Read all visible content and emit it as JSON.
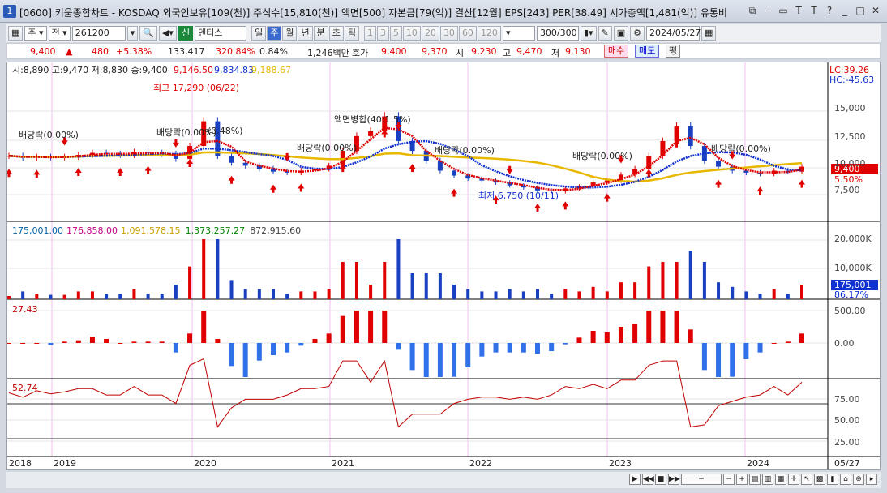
{
  "window": {
    "title": "[0600] 키움종합차트 - KOSDAQ 외국인보유[109(천)] 주식수[15,810(천)] 액면[500] 자본금[79(억)] 결산[12월] EPS[243] PER[38.49] 시가총액[1,481(억)] 유통비",
    "app_icon": "1"
  },
  "toolbar": {
    "period_select": "주",
    "field_select": "전",
    "code": "261200",
    "sin_badge": "신",
    "name": "덴티스",
    "periods": [
      "일",
      "주",
      "월",
      "년",
      "분",
      "초",
      "틱"
    ],
    "active_period": "주",
    "numbers": [
      "1",
      "3",
      "5",
      "10",
      "20",
      "30",
      "60",
      "120"
    ],
    "count": "300/300",
    "date": "2024/05/27"
  },
  "quote": {
    "price": "9,400",
    "change_arrow": "▲",
    "change": "480",
    "rate": "+5.38%",
    "volume": "133,417",
    "volume_rate": "320.84%",
    "turnover": "0.84%",
    "amount": "1,246백만",
    "hoga_label": "호가",
    "ask": "9,400",
    "bid": "9,370",
    "open_label": "시",
    "open": "9,230",
    "high_label": "고",
    "high": "9,470",
    "low_label": "저",
    "low": "9,130",
    "buy_label": "매수",
    "sell_label": "매도",
    "flat_label": "평"
  },
  "price_panel": {
    "ohlc_legend": "시:8,890 고:9,470 저:8,830 종:9,400",
    "ma_values": [
      "9,146.50",
      "9,834.83",
      "9,188.67"
    ],
    "lc": "LC:39.26",
    "hc": "HC:-45.63",
    "high_annot": "최고 17,290 (06/22)",
    "low_annot": "최저 6,750 (10/11)",
    "merge_annot": "액면병합(40:1.5%)",
    "dividend_annots": [
      "배당락(0.00%)",
      "배당락(0.00%)",
      "(0.48%)",
      "배당락(0.00%)",
      "배당락(0.00%)",
      "배당락(0.00%)",
      "배당락(0.00%)"
    ],
    "y_ticks": [
      "15,000",
      "12,500",
      "10,000",
      "7,500"
    ],
    "price_tag": "9,400",
    "pct_tag": "5.50%",
    "signal_up_count": 22,
    "signal_down_count": 7
  },
  "volume_panel": {
    "legend": [
      "175,001.00",
      "176,858.00",
      "1,091,578.15",
      "1,373,257.27",
      "872,915.60"
    ],
    "legend_colors": [
      "#0060a0",
      "#c00080",
      "#c8a000",
      "#008000",
      "#444444"
    ],
    "y_ticks": [
      "20,000K",
      "10,000K"
    ],
    "tag_value": "175,001",
    "tag_pct": "86.17%"
  },
  "macd_panel": {
    "value": "27.43",
    "y_ticks": [
      "500.00",
      "0.00"
    ]
  },
  "rsi_panel": {
    "value": "52.74",
    "y_ticks": [
      "75.00",
      "50.00",
      "25.00"
    ]
  },
  "x_axis": {
    "labels": [
      "2018",
      "2019",
      "2020",
      "2021",
      "2022",
      "2023",
      "2024"
    ],
    "end_label": "05/27"
  },
  "chart_data": {
    "type": "line",
    "ylim": [
      6000,
      17500
    ],
    "series": [
      {
        "name": "",
        "values": [
          10500,
          10300,
          10400,
          10350,
          10400,
          10600,
          10800,
          10700,
          10600,
          10900,
          10800,
          10700,
          10200,
          11500,
          14000,
          10500,
          9800,
          9500,
          9200,
          8900,
          8800,
          9000,
          9200,
          9500,
          11000,
          12500,
          13000,
          14500,
          12000,
          11000,
          10000,
          9000,
          8500,
          8200,
          8000,
          7800,
          7500,
          7300,
          7000,
          6900,
          7200,
          7400,
          7800,
          8000,
          8600,
          9200,
          10500,
          12000,
          13500,
          11500,
          10000,
          9400,
          9000,
          8800,
          8700,
          9000,
          8900,
          9400
        ]
      }
    ]
  },
  "colors": {
    "candle_up": "#e00000",
    "candle_down": "#1840c0",
    "ma_short": "#e00000",
    "ma_mid": "#1030d0",
    "ma_long": "#e8b800",
    "rsi_line": "#c00000",
    "macd_pos": "#e00000",
    "macd_neg": "#3070e8"
  }
}
